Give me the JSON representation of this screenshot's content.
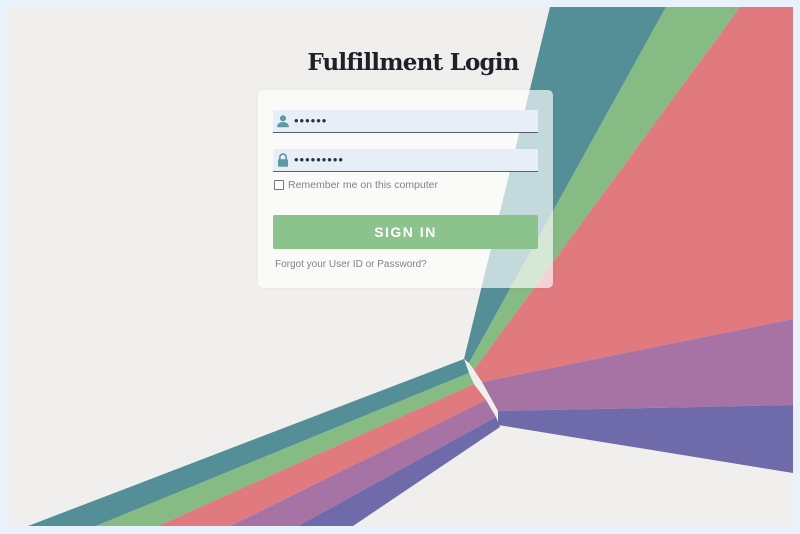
{
  "page": {
    "title": "Fulfillment Login"
  },
  "form": {
    "username_value": "••••••",
    "password_value": "•••••••••",
    "remember_label": "Remember me on this computer",
    "remember_checked": false,
    "submit_label": "SIGN IN",
    "forgot_link": "Forgot your User ID or Password?"
  },
  "icons": {
    "username": "user-icon",
    "password": "lock-icon"
  },
  "colors": {
    "background": "#f1efed",
    "teal": "#548f98",
    "green": "#86bb83",
    "coral": "#e07a7e",
    "purple": "#a772a4",
    "indigo": "#6f6bab",
    "button": "#8cc28c"
  }
}
